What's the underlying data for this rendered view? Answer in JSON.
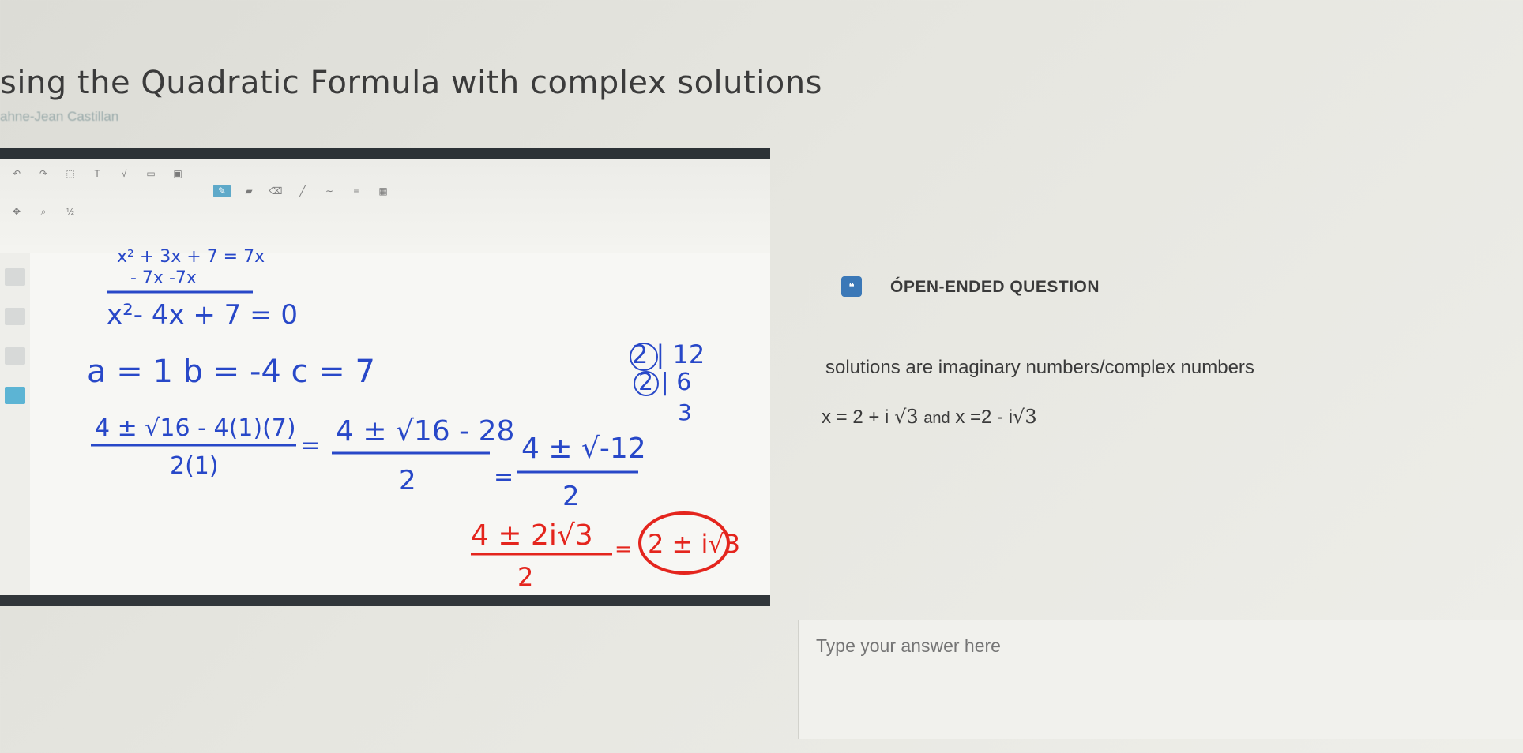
{
  "lesson": {
    "title": "sing the Quadratic Formula with complex solutions",
    "author": "ahne-Jean Castillan"
  },
  "whiteboard": {
    "work": {
      "eq1": "x² + 3x + 7 = 7x",
      "eq1_sub": "- 7x       -7x",
      "eq2": "x²- 4x + 7 = 0",
      "coeffs": "a = 1   b = -4   c = 7",
      "step1_num": "4 ± √16 - 4(1)(7)",
      "step1_den": "2(1)",
      "step2_num": "4 ± √16 - 28",
      "step2_den": "2",
      "step3_num": "4 ± √-12",
      "step3_den": "2",
      "step4_num": "4 ± 2i√3",
      "step4_den": "2",
      "final": "2 ± i√3",
      "factor_top": "2 | 12",
      "factor_mid": "2 | 6",
      "factor_bot": "3",
      "equals": "="
    },
    "ink_colors": {
      "blue": "#2848c8",
      "red": "#e4251d"
    }
  },
  "question": {
    "type_label": "ÓPEN-ENDED QUESTION",
    "icon": "speech-bubble-icon",
    "answer_text": "solutions are imaginary numbers/complex numbers",
    "answer_x1": "x = 2 + i",
    "answer_sqrt1": "√3",
    "answer_and": "and",
    "answer_x2": "x =2 - i",
    "answer_sqrt2": "√3",
    "input_placeholder": "Type your answer here"
  }
}
